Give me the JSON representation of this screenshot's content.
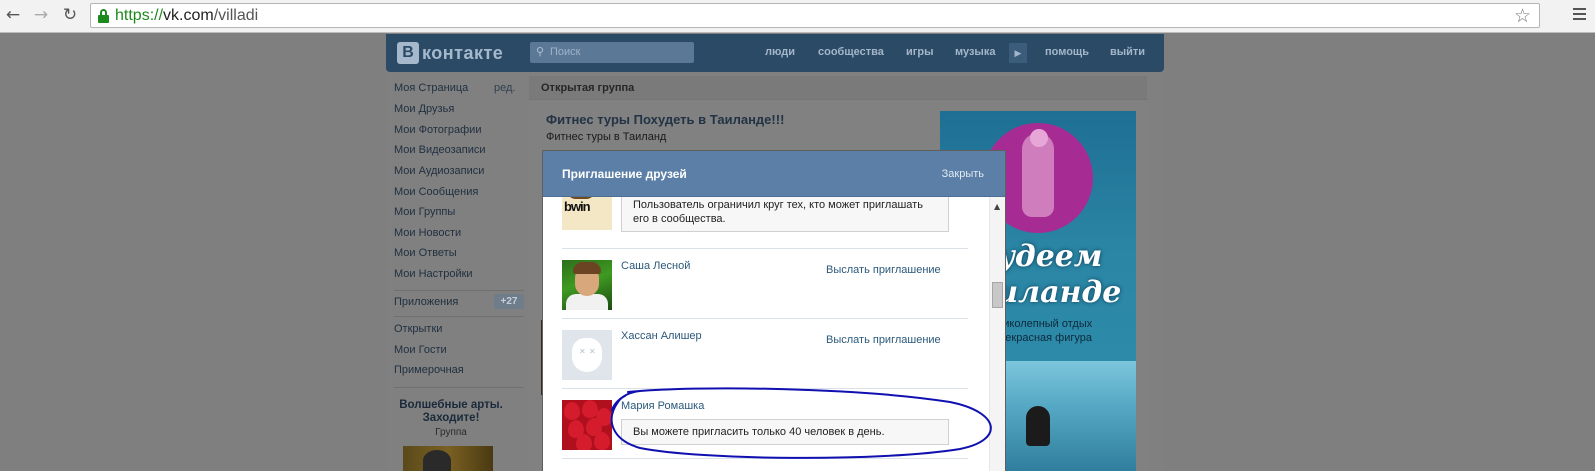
{
  "browser": {
    "url_scheme": "https://",
    "url_domain": "vk.com",
    "url_path": "/villadi"
  },
  "header": {
    "logo_letter": "В",
    "logo_word": "контакте",
    "search_placeholder": "Поиск",
    "nav": [
      "люди",
      "сообщества",
      "игры",
      "музыка",
      "помощь",
      "выйти"
    ]
  },
  "sidebar": {
    "items": [
      "Моя Страница",
      "Мои Друзья",
      "Мои Фотографии",
      "Мои Видеозаписи",
      "Мои Аудиозаписи",
      "Мои Сообщения",
      "Мои Группы",
      "Мои Новости",
      "Мои Ответы",
      "Мои Настройки"
    ],
    "edit_label": "ред.",
    "apps_label": "Приложения",
    "apps_badge": "+27",
    "extra_items": [
      "Открытки",
      "Мои Гости",
      "Примерочная"
    ],
    "promo_title": "Волшебные арты. Заходите!",
    "promo_sub": "Группа"
  },
  "main": {
    "section_title": "Открытая группа",
    "group_title": "Фитнес туры Похудеть в Таиланде!!!",
    "group_subtitle": "Фитнес туры в Таиланд"
  },
  "ad": {
    "line1": "Худеем",
    "line2": "Таиланде",
    "small1": "Великолепный отдых",
    "small2": "и прекрасная фигура"
  },
  "modal": {
    "title": "Приглашение друзей",
    "close_label": "Закрыть",
    "rows": [
      {
        "notice": "Пользователь ограничил круг тех, кто может приглашать его в сообщества."
      },
      {
        "name": "Саша Лесной",
        "action": "Выслать приглашение"
      },
      {
        "name": "Хассан Алишер",
        "action": "Выслать приглашение"
      },
      {
        "name": "Мария Ромашка",
        "notice": "Вы можете пригласить только 40 человек в день."
      }
    ]
  },
  "colors": {
    "header_bg": "#2b4a66",
    "modal_header": "#5b7fa6",
    "link": "#2b587a",
    "annotation_ink": "#1010b0"
  }
}
